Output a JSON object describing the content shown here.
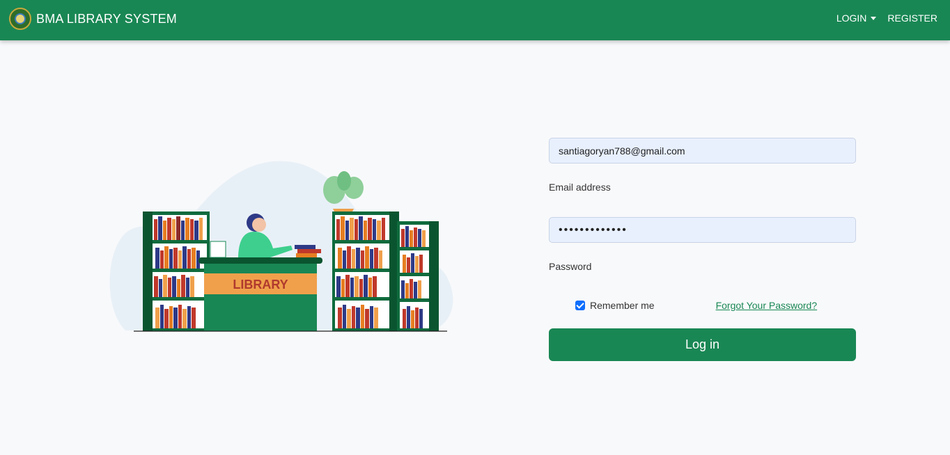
{
  "navbar": {
    "brand": "BMA LIBRARY SYSTEM",
    "login_label": "LOGIN",
    "register_label": "REGISTER"
  },
  "illustration": {
    "desk_sign": "LIBRARY"
  },
  "form": {
    "email_value": "santiagoryan788@gmail.com",
    "email_label": "Email address",
    "password_mask": "•••••••••••••",
    "password_label": "Password",
    "remember_label": "Remember me",
    "remember_checked": true,
    "forgot_label": "Forgot Your Password?",
    "submit_label": "Log in"
  },
  "colors": {
    "primary": "#198754",
    "input_bg": "#e8f0fe",
    "checkbox": "#0d6efd"
  }
}
